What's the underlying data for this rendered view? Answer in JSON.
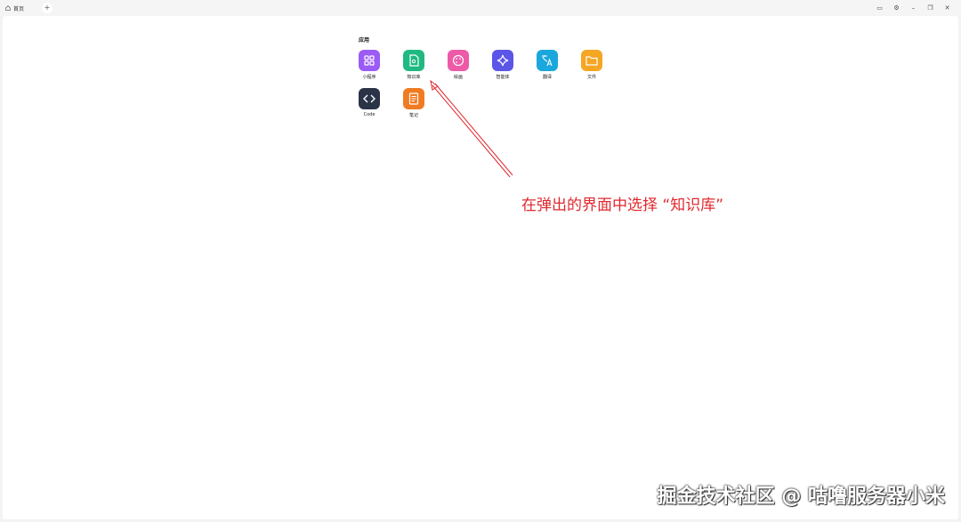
{
  "titlebar": {
    "tab_label": "首页",
    "add_tab_label": "+",
    "controls": [
      "▭",
      "⚙",
      "–",
      "❐",
      "✕"
    ]
  },
  "apps_section": {
    "title": "应用",
    "apps": [
      {
        "label": "小程序",
        "icon": "grid-icon",
        "color": "#9b5cf6"
      },
      {
        "label": "知识库",
        "icon": "knowledge-icon",
        "color": "#1fb981"
      },
      {
        "label": "绘画",
        "icon": "palette-icon",
        "color": "#ec5aa8"
      },
      {
        "label": "智能体",
        "icon": "sparkle-icon",
        "color": "#5b55e8"
      },
      {
        "label": "翻译",
        "icon": "translate-icon",
        "color": "#1aa7dd"
      },
      {
        "label": "文件",
        "icon": "folder-icon",
        "color": "#f5a623"
      },
      {
        "label": "Code",
        "icon": "code-icon",
        "color": "#2b3347"
      },
      {
        "label": "笔记",
        "icon": "note-icon",
        "color": "#f07b22"
      }
    ]
  },
  "annotation": {
    "text": "在弹出的界面中选择 “知识库”",
    "color": "#e0282e"
  },
  "watermark": {
    "text": "掘金技术社区 @ 咕噜服务器小米"
  }
}
